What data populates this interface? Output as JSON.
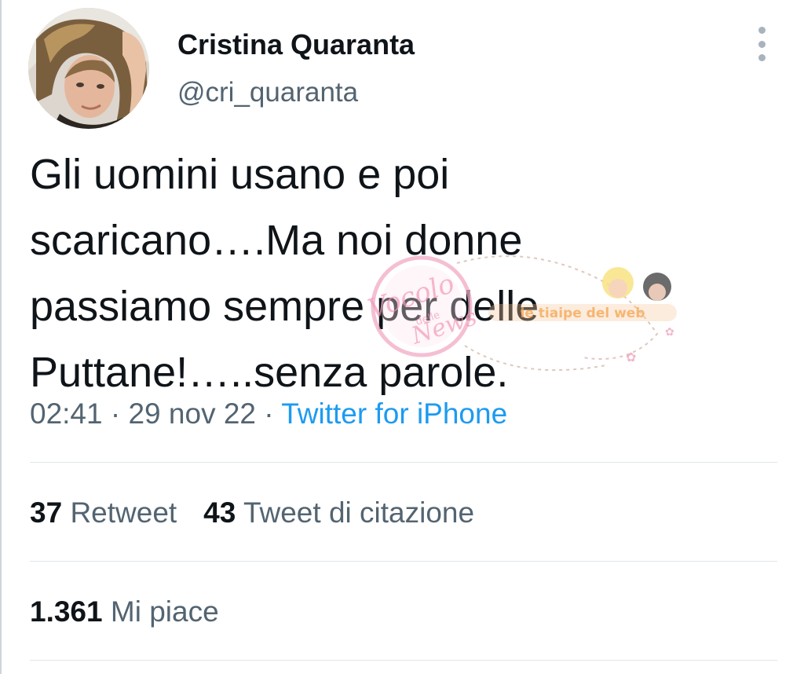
{
  "tweet": {
    "author_name": "Cristina Quaranta",
    "author_handle": "@cri_quaranta",
    "text_lines": [
      "Gli uomini usano e poi",
      "scaricano….Ma noi donne",
      "passiamo sempre per delle",
      "Puttane!…..senza parole."
    ],
    "time": "02:41",
    "date": "29 nov 22",
    "source": "Twitter for iPhone",
    "separator": "·"
  },
  "stats": {
    "retweets_count": "37",
    "retweets_label": "Retweet",
    "quotes_count": "43",
    "quotes_label": "Tweet di citazione",
    "likes_count": "1.361",
    "likes_label": "Mi piace"
  },
  "watermark": {
    "script_word_1": "Vocolo",
    "script_word_2": "delle",
    "script_word_3": "News",
    "banner": "le tiaipe del web"
  },
  "icons": {
    "more": "more-vertical-icon"
  },
  "colors": {
    "name": "#0f1419",
    "secondary": "#536471",
    "link": "#1d9bf0",
    "divider": "#e1e6ea"
  }
}
